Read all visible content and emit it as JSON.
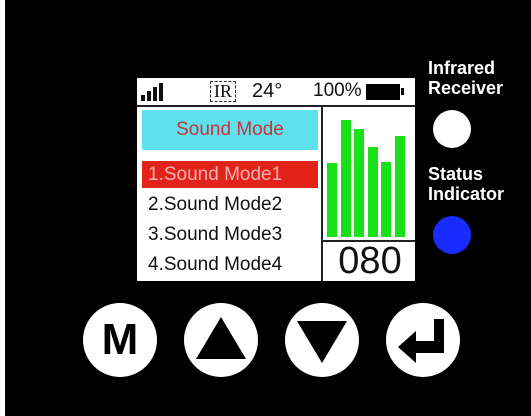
{
  "status_bar": {
    "ir_label": "IR",
    "temperature": "24°",
    "battery_percent": "100%"
  },
  "menu": {
    "title": "Sound Mode",
    "items": [
      {
        "label": "1.Sound Mode1",
        "selected": true
      },
      {
        "label": "2.Sound Mode2",
        "selected": false
      },
      {
        "label": "3.Sound Mode3",
        "selected": false
      },
      {
        "label": "4.Sound Mode4",
        "selected": false
      }
    ]
  },
  "level_meter": {
    "bars": [
      0.6,
      0.95,
      0.88,
      0.73,
      0.61,
      0.82
    ],
    "value": "080"
  },
  "labels": {
    "infrared_line1": "Infrared",
    "infrared_line2": "Receiver",
    "status_line1": "Status",
    "status_line2": "Indicator"
  },
  "buttons": {
    "menu_label": "M",
    "up_icon": "triangle-up",
    "down_icon": "triangle-down",
    "enter_icon": "enter-arrow"
  },
  "colors": {
    "menu_title_bg": "#5ee1ec",
    "selected_bg": "#e2231a",
    "bar": "#19e019",
    "status_led": "#1a2bff"
  }
}
